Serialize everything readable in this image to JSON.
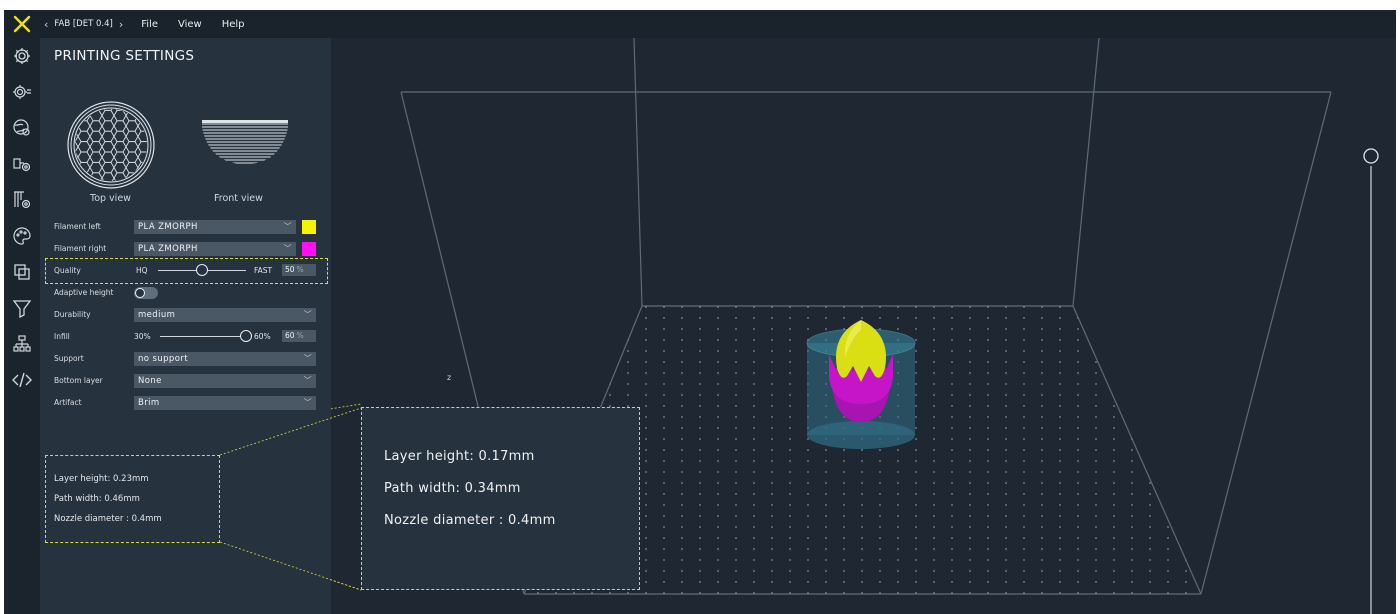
{
  "topbar": {
    "project_name": "FAB [DET 0.4]",
    "prev_arrow": "‹",
    "next_arrow": "›",
    "menu": [
      "File",
      "View",
      "Help"
    ]
  },
  "rail": {
    "icons": [
      "settings-gear-icon",
      "advanced-settings-icon",
      "globe-settings-icon",
      "tool-settings-icon",
      "filament-settings-icon",
      "palette-icon",
      "duplicate-icon",
      "funnel-icon",
      "hierarchy-icon",
      "code-icon"
    ]
  },
  "panel": {
    "title": "PRINTING SETTINGS",
    "top_view_label": "Top view",
    "front_view_label": "Front view",
    "filament_left": {
      "label": "Filament left",
      "value": "PLA ZMORPH",
      "color": "#f5f500"
    },
    "filament_right": {
      "label": "Filament right",
      "value": "PLA ZMORPH",
      "color": "#ff10f0"
    },
    "quality": {
      "label": "Quality",
      "min_label": "HQ",
      "max_label": "FAST",
      "value": "50",
      "unit": "%",
      "level": 0.5
    },
    "adaptive_height": {
      "label": "Adaptive height",
      "enabled": false
    },
    "durability": {
      "label": "Durability",
      "value": "medium"
    },
    "infill": {
      "label": "Infill",
      "min_label": "30%",
      "max_label": "60%",
      "value": "60",
      "unit": "%",
      "level": 1.0
    },
    "support": {
      "label": "Support",
      "value": "no support"
    },
    "bottom_layer": {
      "label": "Bottom layer",
      "value": "None"
    },
    "artifact": {
      "label": "Artifact",
      "value": "Brim"
    },
    "info": {
      "layer_height": "Layer height: 0.23mm",
      "path_width": "Path width: 0.46mm",
      "nozzle_diameter": "Nozzle diameter : 0.4mm"
    }
  },
  "viewport": {
    "axis_label": "z",
    "zoom_info": {
      "layer_height": "Layer height: 0.17mm",
      "path_width": "Path width: 0.34mm",
      "nozzle_diameter": "Nozzle diameter : 0.4mm"
    }
  },
  "colors": {
    "accent": "#f1e400",
    "highlight_dash": "#d8dc3a",
    "model_yellow": "#d9df12",
    "model_magenta": "#c615c8",
    "brim_cyan": "#3a98b0"
  }
}
